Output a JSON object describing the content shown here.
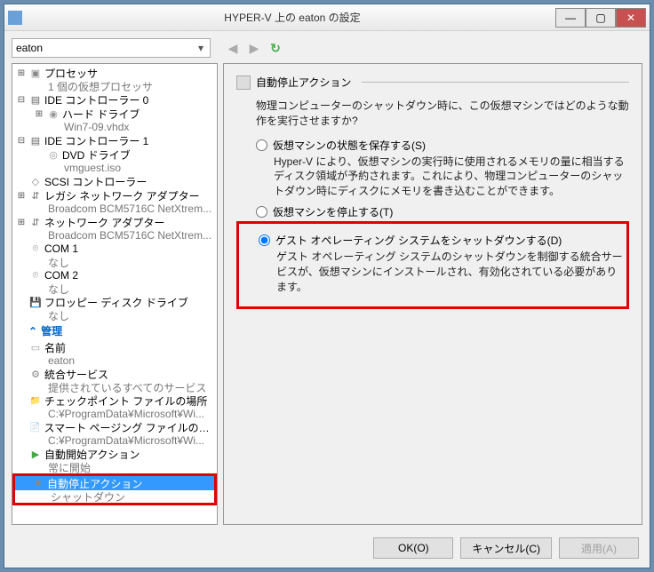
{
  "title": "HYPER-V 上の eaton の設定",
  "combo": {
    "value": "eaton"
  },
  "tree": {
    "processor": {
      "label": "プロセッサ",
      "sub": "1 個の仮想プロセッサ"
    },
    "ide0": {
      "label": "IDE コントローラー 0",
      "hdd": "ハード ドライブ",
      "hdd_sub": "Win7-09.vhdx"
    },
    "ide1": {
      "label": "IDE コントローラー 1",
      "dvd": "DVD ドライブ",
      "dvd_sub": "vmguest.iso"
    },
    "scsi": {
      "label": "SCSI コントローラー"
    },
    "legacy_net": {
      "label": "レガシ ネットワーク アダプター",
      "sub": "Broadcom BCM5716C NetXtrem..."
    },
    "net": {
      "label": "ネットワーク アダプター",
      "sub": "Broadcom BCM5716C NetXtrem..."
    },
    "com1": {
      "label": "COM 1",
      "sub": "なし"
    },
    "com2": {
      "label": "COM 2",
      "sub": "なし"
    },
    "fdd": {
      "label": "フロッピー ディスク ドライブ",
      "sub": "なし"
    },
    "mgmt_section": "管理",
    "name": {
      "label": "名前",
      "sub": "eaton"
    },
    "svc": {
      "label": "統合サービス",
      "sub": "提供されているすべてのサービス"
    },
    "chk": {
      "label": "チェックポイント ファイルの場所",
      "sub": "C:¥ProgramData¥Microsoft¥Wi..."
    },
    "page": {
      "label": "スマート ページング ファイルの場所",
      "sub": "C:¥ProgramData¥Microsoft¥Wi..."
    },
    "autostart": {
      "label": "自動開始アクション",
      "sub": "常に開始"
    },
    "autostop": {
      "label": "自動停止アクション",
      "sub": "シャットダウン"
    }
  },
  "right": {
    "title": "自動停止アクション",
    "desc": "物理コンピューターのシャットダウン時に、この仮想マシンではどのような動作を実行させますか?",
    "opt1": {
      "label": "仮想マシンの状態を保存する(S)",
      "sub": "Hyper-V により、仮想マシンの実行時に使用されるメモリの量に相当するディスク領域が予約されます。これにより、物理コンピューターのシャットダウン時にディスクにメモリを書き込むことができます。"
    },
    "opt2": {
      "label": "仮想マシンを停止する(T)"
    },
    "opt3": {
      "label": "ゲスト オペレーティング システムをシャットダウンする(D)",
      "sub": "ゲスト オペレーティング システムのシャットダウンを制御する統合サービスが、仮想マシンにインストールされ、有効化されている必要があります。"
    }
  },
  "buttons": {
    "ok": "OK(O)",
    "cancel": "キャンセル(C)",
    "apply": "適用(A)"
  }
}
